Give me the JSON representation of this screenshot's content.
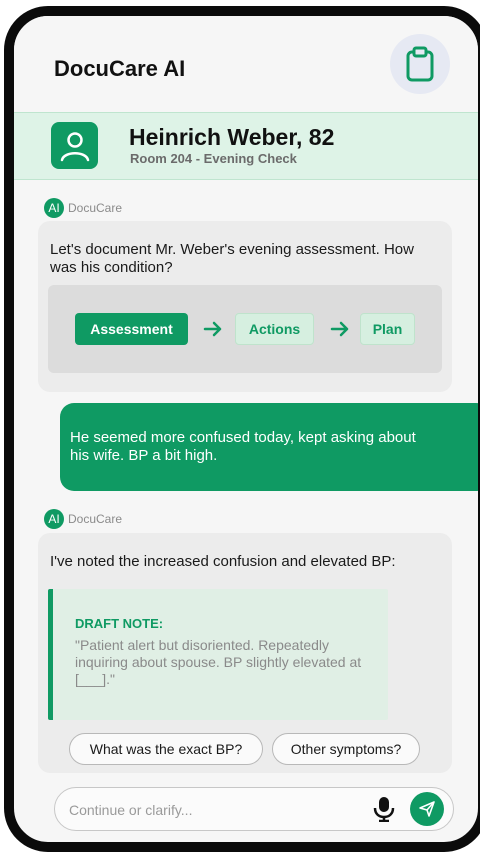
{
  "app": {
    "title": "DocuCare AI"
  },
  "header": {
    "clipboard_icon": "clipboard-icon"
  },
  "patient": {
    "name": "Heinrich Weber, 82",
    "detail": "Room 204 - Evening Check",
    "avatar_icon": "person-icon"
  },
  "messages": [
    {
      "sender_badge": "AI",
      "sender_name": "DocuCare",
      "text": "Let's document Mr. Weber's evening assessment. How was his condition?",
      "flow": [
        "Assessment",
        "Actions",
        "Plan"
      ],
      "flow_active": "Assessment"
    },
    {
      "sender": "user",
      "text": "He seemed more confused today, kept asking about his wife. BP a bit high."
    },
    {
      "sender_badge": "AI",
      "sender_name": "DocuCare",
      "text": "I've noted the increased confusion and elevated BP:",
      "draft_label": "DRAFT NOTE:",
      "draft_text": "\"Patient alert but disoriented. Repeatedly inquiring about spouse. BP slightly elevated at [___].\""
    }
  ],
  "suggestions": [
    "What was the exact BP?",
    "Other symptoms?"
  ],
  "composer": {
    "placeholder": "Continue or clarify...",
    "mic_icon": "mic-icon",
    "send_icon": "send-icon"
  },
  "colors": {
    "accent": "#0f9a63",
    "patient_bar": "#def3e7",
    "ai_bubble": "#ececec"
  }
}
